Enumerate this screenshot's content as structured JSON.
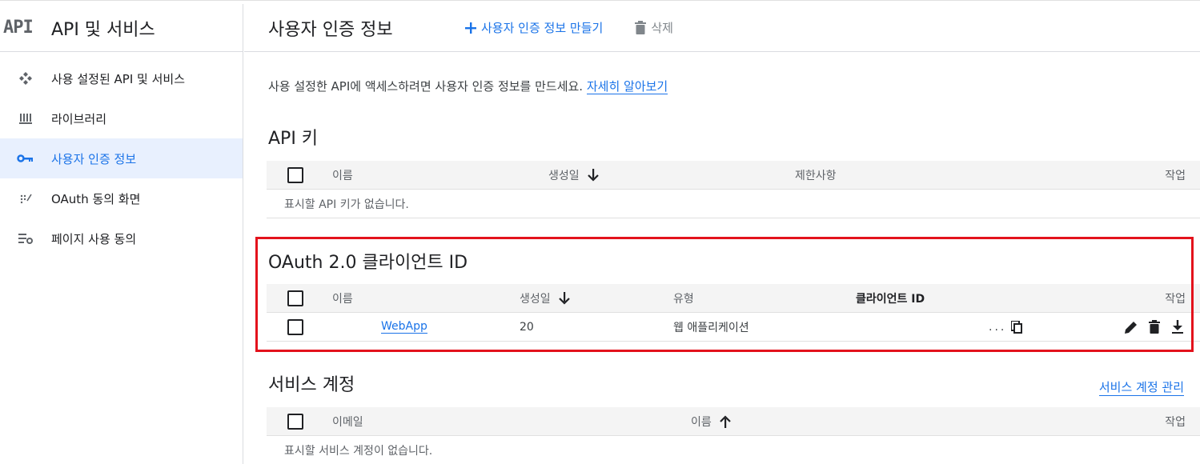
{
  "brand": {
    "logo_text": "API",
    "title": "API 및 서비스"
  },
  "sidebar": {
    "items": [
      {
        "label": "사용 설정된 API 및 서비스",
        "icon": "api-dashboard-icon",
        "active": false
      },
      {
        "label": "라이브러리",
        "icon": "library-icon",
        "active": false
      },
      {
        "label": "사용자 인증 정보",
        "icon": "key-icon",
        "active": true
      },
      {
        "label": "OAuth 동의 화면",
        "icon": "consent-icon",
        "active": false
      },
      {
        "label": "페이지 사용 동의",
        "icon": "settings-list-icon",
        "active": false
      }
    ]
  },
  "header": {
    "title": "사용자 인증 정보",
    "create_label": "사용자 인증 정보 만들기",
    "delete_label": "삭제"
  },
  "intro": {
    "text": "사용 설정한 API에 액세스하려면 사용자 인증 정보를 만드세요.",
    "link": "자세히 알아보기"
  },
  "api_keys": {
    "title": "API 키",
    "columns": {
      "name": "이름",
      "created": "생성일",
      "restrictions": "제한사항",
      "actions": "작업"
    },
    "empty": "표시할 API 키가 없습니다."
  },
  "oauth": {
    "title": "OAuth 2.0 클라이언트 ID",
    "columns": {
      "name": "이름",
      "created": "생성일",
      "type": "유형",
      "client_id": "클라이언트 ID",
      "actions": "작업"
    },
    "rows": [
      {
        "name": "WebApp",
        "created": "20",
        "type": "웹 애플리케이션",
        "client_id": "..."
      }
    ]
  },
  "service_accounts": {
    "title": "서비스 계정",
    "manage_link": "서비스 계정 관리",
    "columns": {
      "email": "이메일",
      "name": "이름",
      "actions": "작업"
    },
    "empty": "표시할 서비스 계정이 없습니다."
  },
  "colors": {
    "accent": "#1a73e8",
    "highlight": "#e3121c",
    "active_bg": "#e8f0fe"
  }
}
